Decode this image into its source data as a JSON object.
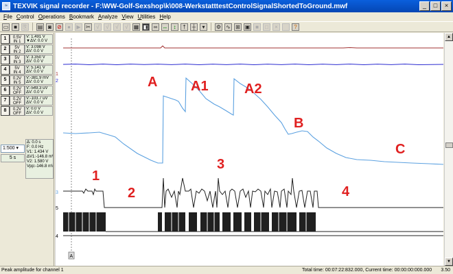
{
  "window": {
    "title": "TEXVIK signal recorder - F:\\WW-Golf-Sexshop\\k\\008-WerkstatttestControlSignalShortedToGround.mwf",
    "buttons": [
      "_",
      "□",
      "×"
    ]
  },
  "menu": [
    "File",
    "Control",
    "Operations",
    "Bookmark",
    "Analyze",
    "View",
    "Utilities",
    "Help"
  ],
  "channels": [
    {
      "num": "1",
      "range": "0.5V",
      "input": "IN 1",
      "v": "V: 1.491 V",
      "dv": "▼ΔV:  0.0 V"
    },
    {
      "num": "2",
      "range": "5V",
      "input": "IN 2",
      "v": "V: 3.098 V",
      "dv": "ΔV:  0.0 V"
    },
    {
      "num": "3",
      "range": "5V",
      "input": "IN 3",
      "v": "V: 3.350 V",
      "dv": "ΔV:  0.0 V"
    },
    {
      "num": "4",
      "range": "5V",
      "input": "IN 4",
      "v": "V: 5.141 V",
      "dv": "ΔV:  0.0 V"
    },
    {
      "num": "5",
      "range": "0.2V",
      "input": "IN 5",
      "v": "V:-381.9 mV",
      "dv": "ΔV:  0.0 V"
    },
    {
      "num": "6",
      "range": "0.2V",
      "input": "OFF",
      "v": "V:-549.3 uV",
      "dv": "ΔV:  0.0 V"
    },
    {
      "num": "7",
      "range": "0.2V",
      "input": "OFF",
      "v": "V:-103.7 uV",
      "dv": "ΔV:  0.0 V"
    },
    {
      "num": "8",
      "range": "0.2V",
      "input": "OFF",
      "v": "V:  0.0 V",
      "dv": "ΔV:  0.0 V"
    }
  ],
  "timebase": {
    "scale": "1:500",
    "duration": "5 s"
  },
  "measure": {
    "t": "Δ:  0.0 s",
    "f": "F:  0.0 Hz",
    "v1": "V1: 1.434 V",
    "dv1": "ΔV1:-146.8 mV",
    "v2": "V2: 1.580 V",
    "vpp": "Vpp:-146.8 mV"
  },
  "annotations": {
    "A": "A",
    "A1": "A1",
    "A2": "A2",
    "B": "B",
    "C": "C",
    "n1": "1",
    "n2": "2",
    "n3": "3",
    "n4": "4"
  },
  "trace_labels": {
    "t1": "1",
    "t2": "2",
    "t3": "3",
    "t4": "4",
    "t5": "5"
  },
  "cursor_label": "A",
  "status": {
    "left": "Peak amplitude for channel 1",
    "total_time": "Total time: 00:07:22:832.000, Current time: 00:00:00:000.000",
    "zoom": "3.50"
  },
  "colors": {
    "ch1": "#a03030",
    "ch2": "#2a2ad0",
    "ch3": "#5aa0e0",
    "annotation": "#e02020",
    "digital": "#202020"
  }
}
